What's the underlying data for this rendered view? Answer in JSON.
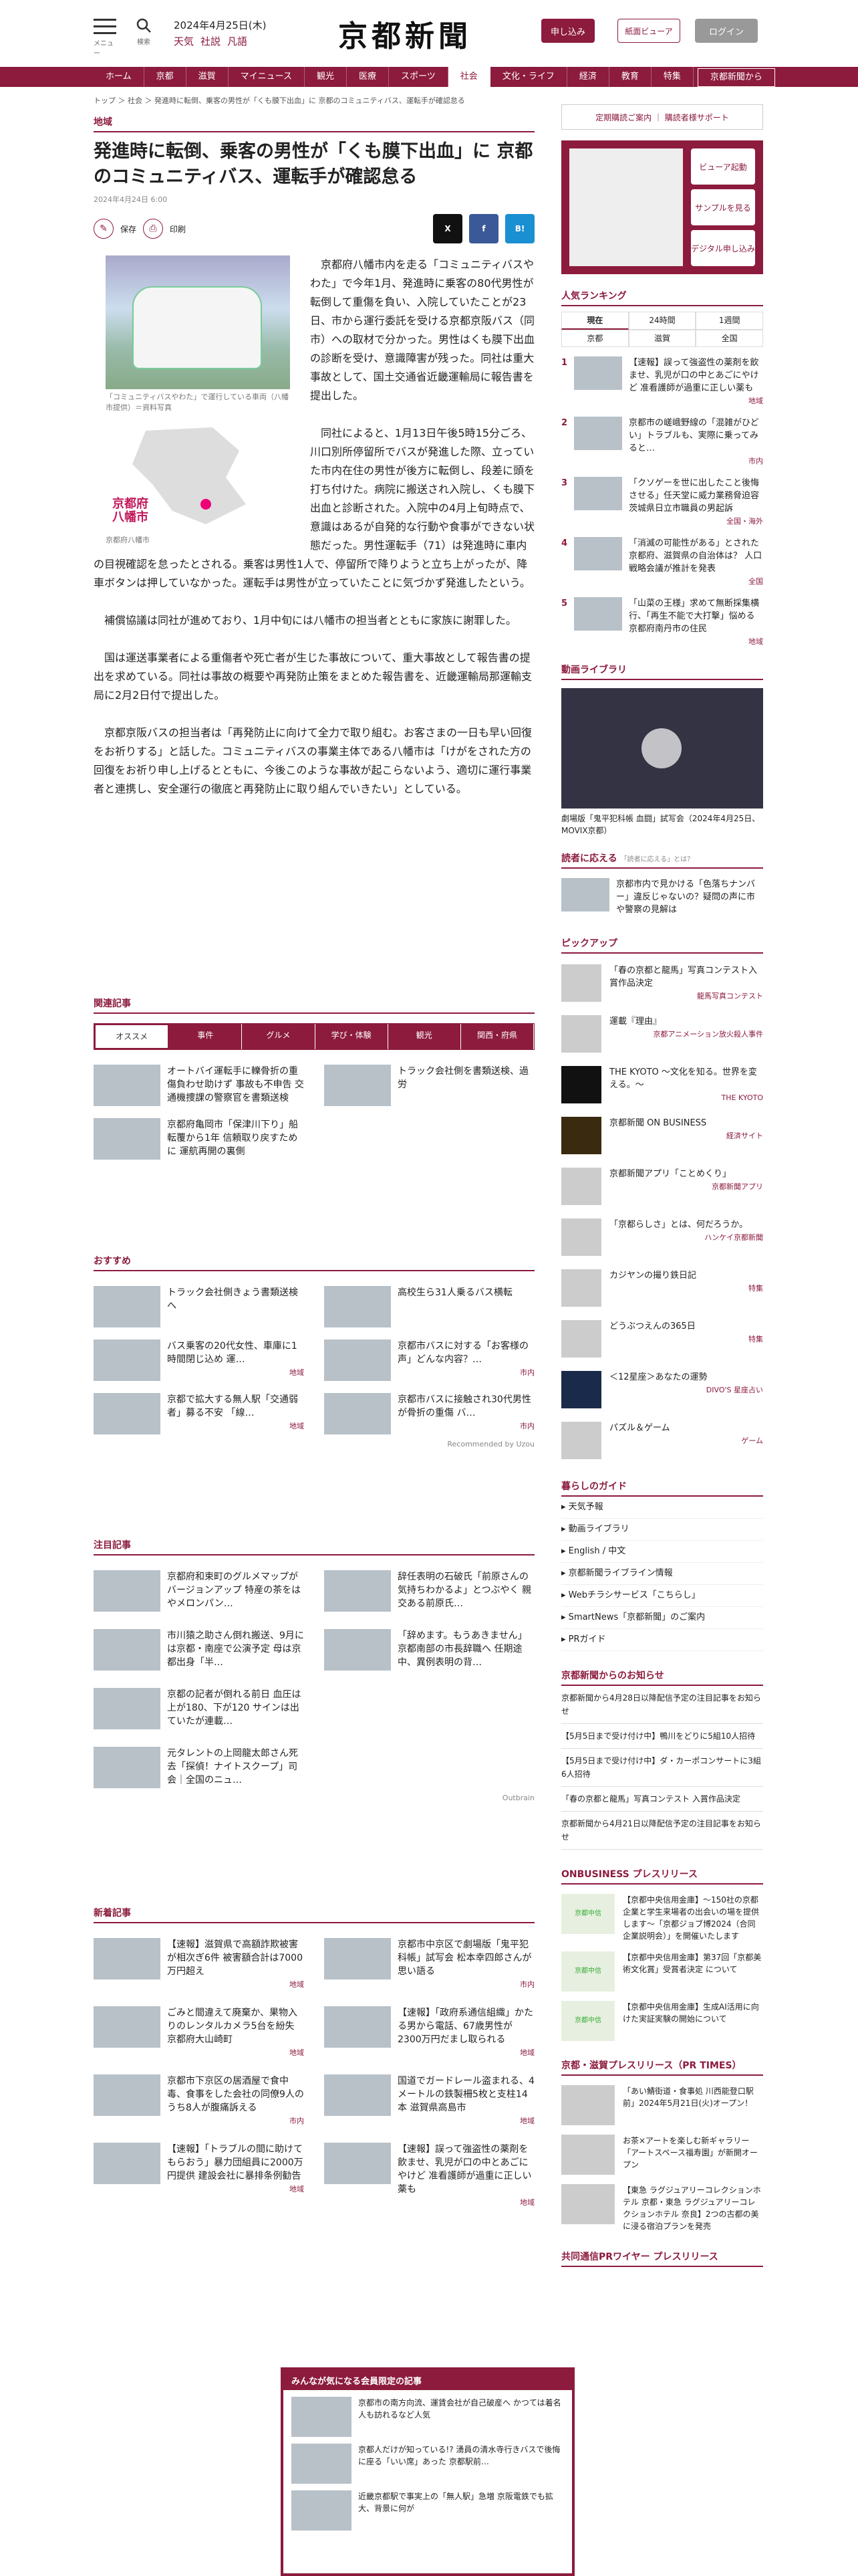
{
  "header": {
    "menu": "メニュー",
    "search": "検索",
    "date": "2024年4月25日(木)",
    "links": [
      "天気",
      "社説",
      "凡語"
    ],
    "logo": "京都新聞",
    "btn_apply": "申し込み",
    "btn_viewer": "紙面ビューア",
    "btn_login": "ログイン"
  },
  "nav": [
    "ホーム",
    "京都",
    "滋賀",
    "マイニュース",
    "観光",
    "医療",
    "スポーツ",
    "社会",
    "文化・ライフ",
    "経済",
    "教育",
    "特集",
    "京都新聞から"
  ],
  "breadcrumb": "トップ ＞ 社会 ＞ 発進時に転倒、乗客の男性が「くも膜下出血」に 京都のコミュニティバス、運転手が確認怠る",
  "article": {
    "category": "地域",
    "title": "発進時に転倒、乗客の男性が「くも膜下出血」に 京都のコミュニティバス、運転手が確認怠る",
    "date": "2024年4月24日 6:00",
    "save": "保存",
    "print": "印刷",
    "caption1": "「コミュニティバスやわた」で運行している車両（八幡市提供）＝資料写真",
    "map_label": "京都府\n八幡市",
    "caption2": "京都府八幡市",
    "paragraphs": [
      "京都府八幡市内を走る「コミュニティバスやわた」で今年1月、発進時に乗客の80代男性が転倒して重傷を負い、入院していたことが23日、市から運行委託を受ける京都京阪バス（同市）への取材で分かった。男性はくも膜下出血の診断を受け、意識障害が残った。同社は重大事故として、国土交通省近畿運輸局に報告書を提出した。",
      "同社によると、1月13日午後5時15分ごろ、川口別所停留所でバスが発進した際、立っていた市内在住の男性が後方に転倒し、段差に頭を打ち付けた。病院に搬送され入院し、くも膜下出血と診断された。入院中の4月上旬時点で、意識はあるが自発的な行動や食事ができない状態だった。男性運転手（71）は発進時に車内の目視確認を怠ったとされる。乗客は男性1人で、停留所で降りようと立ち上がったが、降車ボタンは押していなかった。運転手は男性が立っていたことに気づかず発進したという。",
      "補償協議は同社が進めており、1月中旬には八幡市の担当者とともに家族に謝罪した。",
      "国は運送事業者による重傷者や死亡者が生じた事故について、重大事故として報告書の提出を求めている。同社は事故の概要や再発防止策をまとめた報告書を、近畿運輸局那運輸支局に2月2日付で提出した。",
      "京都京阪バスの担当者は「再発防止に向けて全力で取り組む。お客さまの一日も早い回復をお祈りする」と話した。コミュニティバスの事業主体である八幡市は「けがをされた方の回復をお祈り申し上げるとともに、今後このような事故が起こらないよう、適切に運行事業者と連携し、安全運行の徹底と再発防止に取り組んでいきたい」としている。"
    ]
  },
  "related": {
    "heading": "関連記事",
    "tabs": [
      "オススメ",
      "事件",
      "グルメ",
      "学び・体験",
      "観光",
      "関西・府県"
    ],
    "items": [
      {
        "t": "オートバイ運転手に轢骨折の重傷負わせ助けず 事故も不申告 交通機捜課の警察官を書類送検",
        "g": ""
      },
      {
        "t": "トラック会社側を書類送検、過労",
        "g": ""
      },
      {
        "t": "京都府亀岡市「保津川下り」船転覆から1年 信頼取り戻すために 運航再開の裏側",
        "g": ""
      }
    ]
  },
  "recommend": {
    "heading": "おすすめ",
    "items": [
      {
        "t": "トラック会社側きょう書類送検へ",
        "g": ""
      },
      {
        "t": "高校生ら31人乗るバス横転",
        "g": ""
      },
      {
        "t": "バス乗客の20代女性、車庫に1時間閉じ込め 運…",
        "g": "地域"
      },
      {
        "t": "京都市バスに対する「お客様の声」どんな内容？…",
        "g": "市内"
      },
      {
        "t": "京都で拡大する無人駅「交通弱者」募る不安 「線…",
        "g": "地域"
      },
      {
        "t": "京都市バスに接触され30代男性が骨折の重傷 バ…",
        "g": "市内"
      }
    ],
    "credit": "Recommended by Uzou"
  },
  "attention": {
    "heading": "注目記事",
    "items": [
      {
        "t": "京都府和束町のグルメマップがバージョンアップ 特産の茶をはやメロンパン…"
      },
      {
        "t": "辞任表明の石破氏「前原さんの気持ちわかるよ」とつぶやく 親交ある前原氏…"
      },
      {
        "t": "市川猿之助さん倒れ搬送、9月には京都・南座で公演予定 母は京都出身「半…"
      },
      {
        "t": "「辞めます。もうあきません」京都南部の市長辞職へ 任期途中、異例表明の背…"
      },
      {
        "t": "京都の記者が倒れる前日 血圧は上が180、下が120 サインは出ていたが連載…"
      },
      {
        "t": "元タレントの上岡龍太郎さん死去「探偵！ナイトスクープ」司会｜全国のニュ…"
      }
    ],
    "credit": "Outbrain"
  },
  "newest": {
    "heading": "新着記事",
    "items": [
      {
        "t": "【速報】滋賀県で高額詐欺被害が相次ぎ6件 被害額合計は7000万円超え",
        "g": "地域"
      },
      {
        "t": "京都市中京区で劇場版「鬼平犯科帳」試写会 松本幸四郎さんが思い語る",
        "g": "市内"
      },
      {
        "t": "ごみと間違えて廃棄か、果物入りのレンタルカメラ5台を紛失 京都府大山崎町",
        "g": "地域"
      },
      {
        "t": "【速報】「政府系通信組織」かたる男から電話、67歳男性が2300万円だまし取られる",
        "g": "地域"
      },
      {
        "t": "京都市下京区の居酒屋で食中毒、食事をした会社の同僚9人のうち8人が腹痛訴える",
        "g": "市内"
      },
      {
        "t": "国道でガードレール盗まれる、4メートルの鉄製柵5枚と支柱14本 滋賀県高島市",
        "g": "地域"
      },
      {
        "t": "【速報】「トラブルの間に助けてもらおう」暴力団組員に2000万円提供 建設会社に暴排条例勧告",
        "g": "地域"
      },
      {
        "t": "【速報】誤って強盗性の薬剤を飲ませ、乳児が口の中とあごにやけど 准看護師が過重に正しい薬も",
        "g": "地域"
      }
    ]
  },
  "side": {
    "top_links": "定期購読ご案内 ｜ 購読者様サポート",
    "paper_btns": [
      "ビューア起動",
      "サンプルを見る",
      "デジタル申し込み"
    ],
    "ranking": {
      "heading": "人気ランキング",
      "tabs": [
        "現在",
        "24時間",
        "1週間",
        "京都",
        "滋賀",
        "全国"
      ],
      "items": [
        {
          "n": "1",
          "t": "【速報】誤って強盗性の薬剤を飲ませ、乳児が口の中とあごにやけど 准看護師が過重に正しい薬も",
          "g": "地域"
        },
        {
          "n": "2",
          "t": "京都市の嵯峨野線の「混雑がひどい」トラブルも、実際に乗ってみると…",
          "g": "市内"
        },
        {
          "n": "3",
          "t": "「クソゲーを世に出したこと後悔させる」任天堂に威力業務脅迫容 茨城県日立市職員の男起訴",
          "g": "全国・海外"
        },
        {
          "n": "4",
          "t": "「消滅の可能性がある」とされた京都府、滋賀県の自治体は？ 人口戦略会議が推計を発表",
          "g": "全国"
        },
        {
          "n": "5",
          "t": "「山菜の王様」求めて無断採集横行、「再生不能で大打撃」悩める京都府南丹市の住民",
          "g": "地域"
        }
      ]
    },
    "video": {
      "heading": "動画ライブラリ",
      "caption": "劇場版「鬼平犯科帳 血闘」試写会（2024年4月25日、MOVIX京都）"
    },
    "reader": {
      "heading": "読者に応える",
      "sub": "「読者に応える」とは？",
      "t": "京都市内で見かける「色落ちナンバー」違反じゃないの？疑問の声に市や警察の見解は"
    },
    "pickup": {
      "heading": "ピックアップ",
      "items": [
        {
          "t": "「春の京都と龍馬」写真コンテスト入賞作品決定",
          "g": "龍馬写真コンテスト"
        },
        {
          "t": "運載『理由』",
          "g": "京都アニメーション放火殺人事件"
        },
        {
          "t": "THE KYOTO 〜文化を知る。世界を変える。〜",
          "g": "THE KYOTO"
        },
        {
          "t": "京都新聞 ON BUSINESS",
          "g": "経済サイト"
        },
        {
          "t": "京都新聞アプリ「ことめくり」",
          "g": "京都新聞アプリ"
        },
        {
          "t": "「京都らしさ」とは、何だろうか。",
          "g": "ハンケイ京都新聞"
        },
        {
          "t": "カジヤンの撮り鉄日記",
          "g": "特集"
        },
        {
          "t": "どうぶつえんの365日",
          "g": "特集"
        },
        {
          "t": "＜12星座＞あなたの運勢",
          "g": "DIVO'S 星座占い"
        },
        {
          "t": "パズル＆ゲーム",
          "g": "ゲーム"
        }
      ]
    },
    "guide": {
      "heading": "暮らしのガイド",
      "items": [
        "▸ 天気予報",
        "▸ 動画ライブラリ",
        "▸ English / 中文",
        "▸ 京都新聞ライブライン情報",
        "▸ Webチラシサービス「こちらし」",
        "▸ SmartNews「京都新聞」のご案内",
        "▸ PRガイド"
      ]
    },
    "notice": {
      "heading": "京都新聞からのお知らせ",
      "items": [
        "京都新聞から4月28日以降配信予定の注目記事をお知らせ",
        "【5月5日まで受け付け中】鴨川をどりに5組10人招待",
        "【5月5日まで受け付け中】ダ・カーポコンサートに3組6人招待",
        "「春の京都と龍馬」写真コンテスト 入賞作品決定",
        "京都新聞から4月21日以降配信予定の注目記事をお知らせ"
      ]
    },
    "onbiz": {
      "heading": "ONBUSINESS プレスリリース",
      "items": [
        "【京都中央信用金庫】〜150社の京都企業と学生来場者の出会いの場を提供します〜「京都ジョブ博2024（合同企業説明会）」を開催いたします",
        "【京都中央信用金庫】第37回「京都美術文化賞」受賞者決定 について",
        "【京都中央信用金庫】生成AI活用に向けた実証実験の開始について"
      ]
    },
    "prtimes": {
      "heading": "京都・滋賀プレスリリース（PR TIMES）",
      "items": [
        "「あい鯖街道・食事処 川西能登口駅前」2024年5月21日(火)オープン！",
        "お茶×アートを楽しむ新ギャラリー「アートスペース福寿園」が新開オープン",
        "【東急 ラグジュアリーコレクションホテル 京都・東急 ラグジュアリーコレクションホテル 奈良】2つの古都の美に浸る宿泊プランを発売"
      ]
    },
    "prwire": "共同通信PRワイヤー プレスリリース"
  },
  "popup": {
    "heading": "みんなが気になる会員限定の記事",
    "items": [
      "京都市の南方向流、運賃会社が自己破産へ かつては着名人も訪れるなど人気",
      "京都人だけが知っている!? 湧員の清水寺行きバスで後悔に座る「いい席」あった 京都駅前…",
      "近畿京都駅で事実上の「無人駅」急増 京阪電鉄でも拡大、背景に何が"
    ]
  }
}
